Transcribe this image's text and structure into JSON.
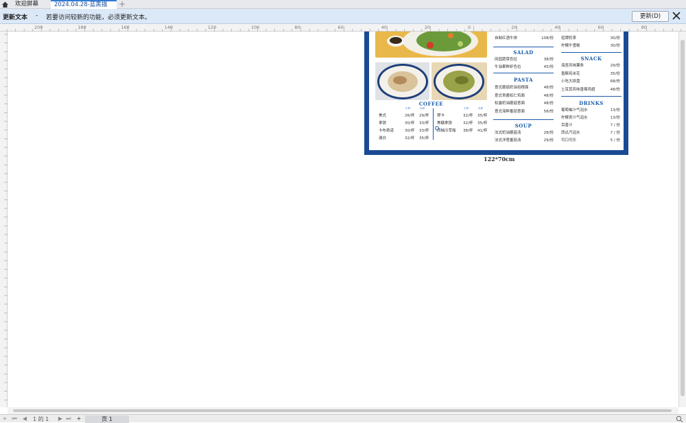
{
  "tabs": [
    {
      "label": "欢迎屏幕"
    },
    {
      "label": "2024.04.28-蓝黑描餐...*"
    }
  ],
  "infobar": {
    "title": "更新文本",
    "sep": "-",
    "message": "若要访问较新的功能，必须更新文本。",
    "update_label": "更新(D)"
  },
  "ruler_top": [
    "200",
    "180",
    "160",
    "140",
    "120",
    "100",
    "80",
    "60",
    "40",
    "20",
    "0",
    "20",
    "40",
    "60",
    "80"
  ],
  "menu": {
    "top_items": [
      {
        "name": "自制红酒牛排",
        "price": "108/份"
      },
      {
        "name": "招牌奶茶",
        "price": "30/份"
      },
      {
        "name": "柠檬牛雪糕",
        "price": "30/份"
      }
    ],
    "salad": {
      "title": "SALAD",
      "items": [
        {
          "name": "田园蔬菜色拉",
          "price": "38/份"
        },
        {
          "name": "牛油果鲜虾色拉",
          "price": "45/份"
        }
      ]
    },
    "pasta": {
      "title": "PASTA",
      "items": [
        {
          "name": "意式蘑菇奶油培根面",
          "price": "48/份"
        },
        {
          "name": "意式青酱松仁鸡面",
          "price": "48/份"
        },
        {
          "name": "松露奶油蘑菇意面",
          "price": "48/份"
        },
        {
          "name": "意式海鲜番茄意面",
          "price": "58/份"
        }
      ]
    },
    "soup": {
      "title": "SOUP",
      "items": [
        {
          "name": "法式奶油蘑菇汤",
          "price": "28/份"
        },
        {
          "name": "法式洋葱番茄汤",
          "price": "29/份"
        }
      ]
    },
    "snack": {
      "title": "SNACK",
      "items": [
        {
          "name": "海苔风味薯条",
          "price": "29/份"
        },
        {
          "name": "香酥鸡米花",
          "price": "35/份"
        },
        {
          "name": "小吃大拼盘",
          "price": "68/份"
        },
        {
          "name": "土耳其风味香辣鸡翅",
          "price": "48/份"
        }
      ]
    },
    "drinks": {
      "title": "DRINKS",
      "items": [
        {
          "name": "葡萄柚汁气泡水",
          "price": "13/份"
        },
        {
          "name": "柠檬青汁气泡水",
          "price": "13/份"
        },
        {
          "name": "百香汁",
          "price": "7 / 份"
        },
        {
          "name": "西瓜汽泡水",
          "price": "7 / 份"
        },
        {
          "name": "可口可乐",
          "price": "5 / 份"
        }
      ]
    },
    "coffee": {
      "title": "COFFEE",
      "size_small": "小杯",
      "size_large": "大杯",
      "left": [
        {
          "name": "美式",
          "small": "26/杯",
          "large": "29/杯"
        },
        {
          "name": "拿铁",
          "small": "30/杯",
          "large": "33/杯"
        },
        {
          "name": "卡布奇诺",
          "small": "30/杯",
          "large": "33/杯"
        },
        {
          "name": "澳白",
          "small": "32/杯",
          "large": "35/杯"
        }
      ],
      "right": [
        {
          "name": "摩卡",
          "small": "32/杯",
          "large": "35/杯"
        },
        {
          "name": "焦糖拿铁",
          "small": "32/杯",
          "large": "35/杯"
        },
        {
          "name": "西柚冷萃咖",
          "small": "38/杯",
          "large": "41/杯"
        }
      ]
    },
    "caption": "122*70cm"
  },
  "footer": {
    "page_info": "1 的 1",
    "page_tab": "页 1"
  },
  "colors": {
    "brand_blue": "#1a4a93",
    "accent_blue": "#1a5aa8",
    "infobar": "#dbe8f7"
  }
}
